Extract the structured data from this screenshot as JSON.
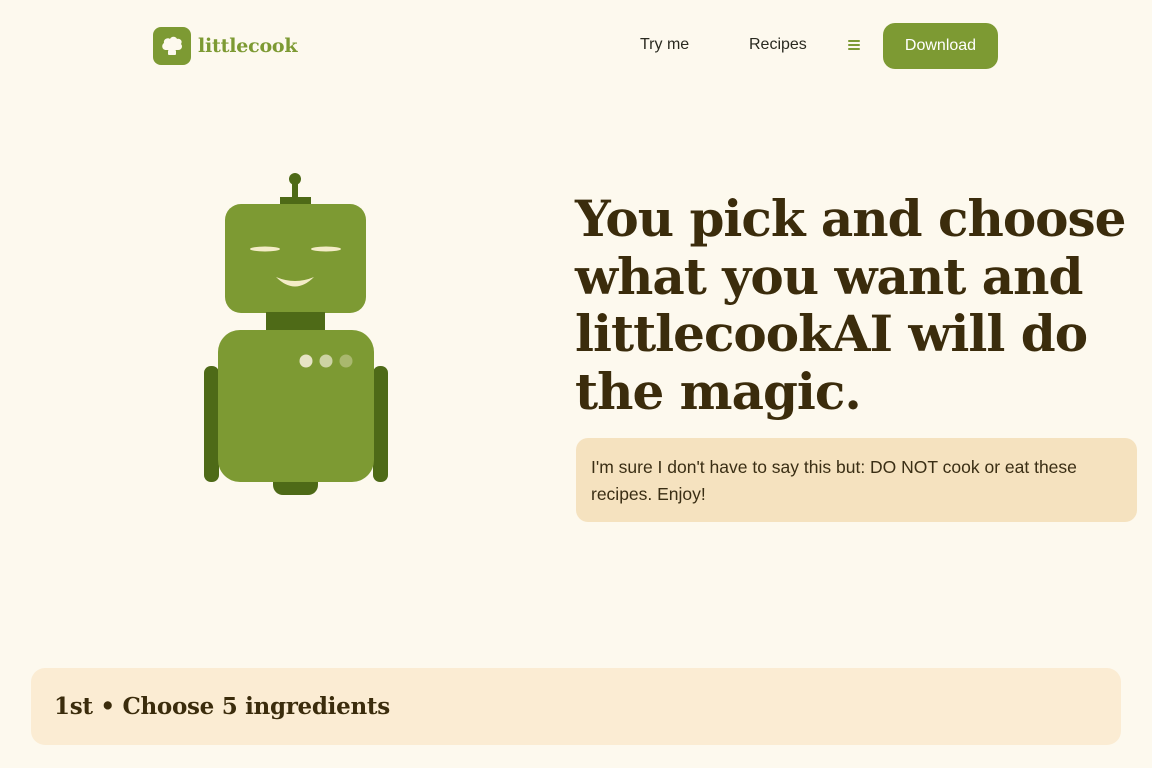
{
  "brand": {
    "name": "littlecook",
    "accent_color": "#7d9a33",
    "logo_icon": "chef-hat-icon"
  },
  "nav": {
    "links": [
      {
        "label": "Try me"
      },
      {
        "label": "Recipes"
      }
    ],
    "menu_icon": "hamburger-menu-icon",
    "download_label": "Download"
  },
  "hero": {
    "illustration": "robot-icon",
    "title": "You pick and choose what you want and littlecookAI will do the magic.",
    "note": "I'm sure I don't have to say this but: DO NOT cook or eat these recipes. Enjoy!"
  },
  "steps": [
    {
      "title": "1st • Choose 5 ingredients"
    }
  ],
  "colors": {
    "background": "#fdf9ee",
    "note_background": "#f5e2bf",
    "card_background": "#fbecd3",
    "heading": "#3b2c0c",
    "robot_light": "#7d9a33",
    "robot_dark": "#4e6a17"
  }
}
